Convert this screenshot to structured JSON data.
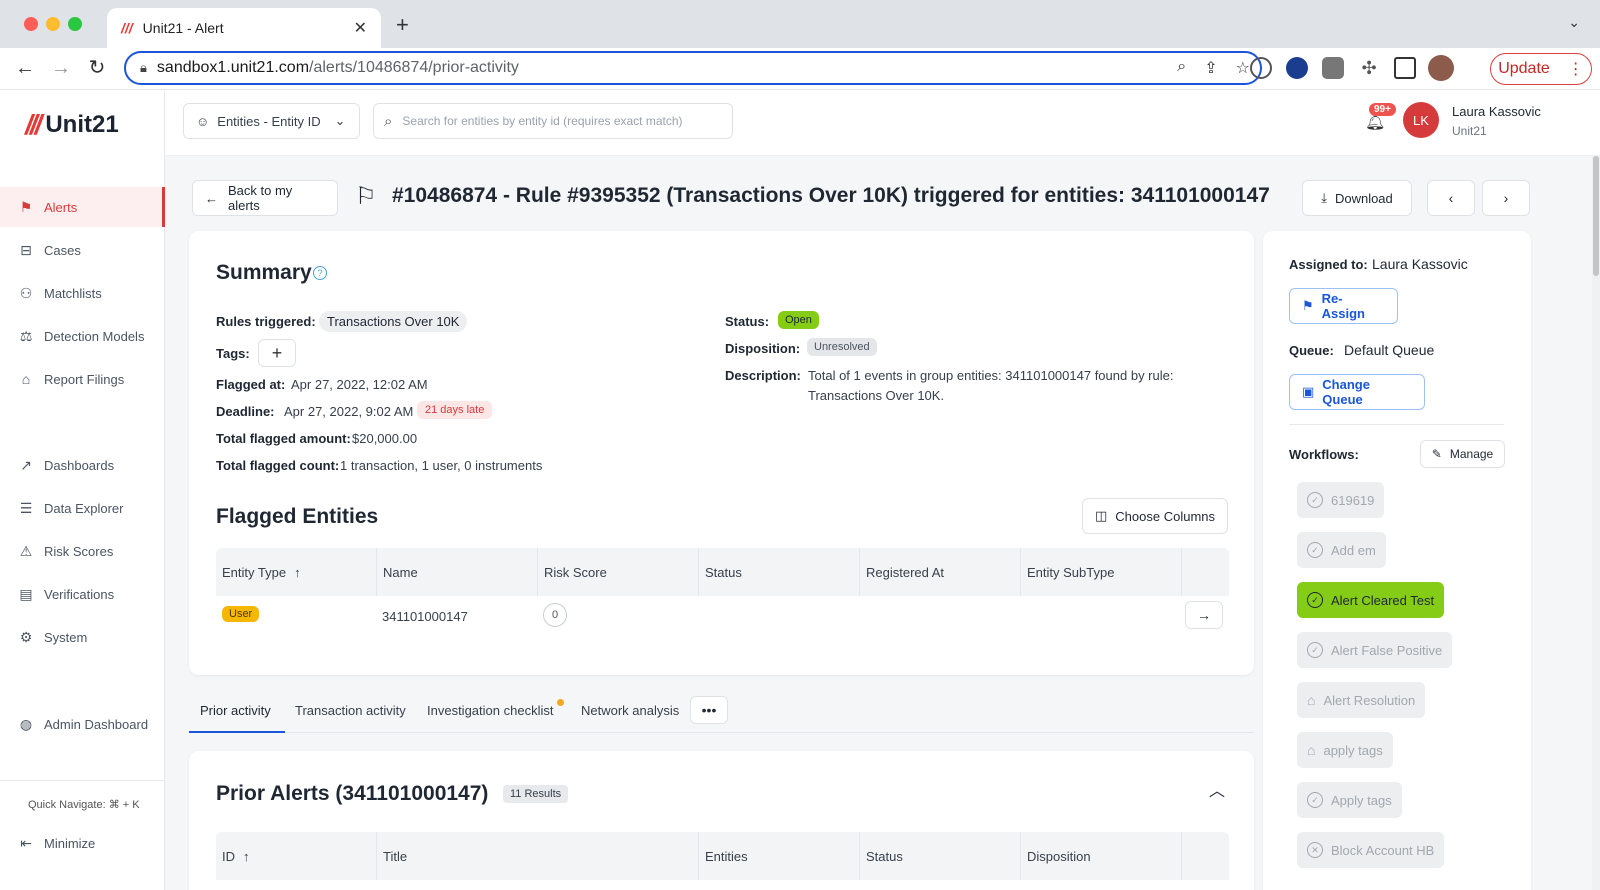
{
  "browser": {
    "tab_title": "Unit21 - Alert",
    "url_host": "sandbox1.unit21.com",
    "url_path": "/alerts/10486874/prior-activity",
    "update_label": "Update"
  },
  "app": {
    "logo_text": "Unit21",
    "sidebar": {
      "items": [
        {
          "label": "Alerts",
          "icon": "flag-icon"
        },
        {
          "label": "Cases",
          "icon": "briefcase-icon"
        },
        {
          "label": "Matchlists",
          "icon": "user-x-icon"
        },
        {
          "label": "Detection Models",
          "icon": "scale-icon"
        },
        {
          "label": "Report Filings",
          "icon": "bank-icon"
        },
        {
          "label": "Dashboards",
          "icon": "chart-line-icon"
        },
        {
          "label": "Data Explorer",
          "icon": "list-search-icon"
        },
        {
          "label": "Risk Scores",
          "icon": "warning-icon"
        },
        {
          "label": "Verifications",
          "icon": "id-card-icon"
        },
        {
          "label": "System",
          "icon": "gear-icon"
        },
        {
          "label": "Admin Dashboard",
          "icon": "globe-icon"
        }
      ],
      "quick_navigate": "Quick Navigate: ⌘ + K",
      "minimize": "Minimize"
    },
    "topbar": {
      "entity_select": "Entities - Entity ID",
      "search_placeholder": "Search for entities by entity id (requires exact match)",
      "notifications": "99+",
      "user_initials": "LK",
      "user_name": "Laura Kassovic",
      "user_org": "Unit21"
    }
  },
  "alert": {
    "back_label": "Back to my alerts",
    "title": "#10486874 - Rule #9395352 (Transactions Over 10K) triggered for entities: 341101000147",
    "download_label": "Download",
    "summary": {
      "heading": "Summary",
      "rules_triggered_label": "Rules triggered:",
      "rules_triggered_value": "Transactions Over 10K",
      "tags_label": "Tags:",
      "flagged_at_label": "Flagged at:",
      "flagged_at_value": "Apr 27, 2022, 12:02 AM",
      "deadline_label": "Deadline:",
      "deadline_value": "Apr 27, 2022, 9:02 AM",
      "deadline_badge": "21 days late",
      "total_amount_label": "Total flagged amount:",
      "total_amount_value": "$20,000.00",
      "total_count_label": "Total flagged count:",
      "total_count_value": "1 transaction, 1 user, 0 instruments",
      "status_label": "Status:",
      "status_value": "Open",
      "disposition_label": "Disposition:",
      "disposition_value": "Unresolved",
      "description_label": "Description:",
      "description_line1": "Total of 1 events in group entities: 341101000147 found by rule:",
      "description_line2": "Transactions Over 10K."
    },
    "flagged_entities": {
      "heading": "Flagged Entities",
      "choose_columns": "Choose Columns",
      "columns": [
        "Entity Type",
        "Name",
        "Risk Score",
        "Status",
        "Registered At",
        "Entity SubType"
      ],
      "rows": [
        {
          "entity_type": "User",
          "name": "341101000147",
          "risk_score": "0"
        }
      ]
    },
    "tabs": [
      "Prior activity",
      "Transaction activity",
      "Investigation checklist",
      "Network analysis"
    ],
    "prior_alerts": {
      "heading": "Prior Alerts (341101000147)",
      "results": "11 Results",
      "columns": [
        "ID",
        "Title",
        "Entities",
        "Status",
        "Disposition"
      ]
    }
  },
  "right_panel": {
    "assigned_label": "Assigned to:",
    "assigned_value": "Laura Kassovic",
    "reassign": "Re-Assign",
    "queue_label": "Queue:",
    "queue_value": "Default Queue",
    "change_queue": "Change Queue",
    "workflows_label": "Workflows:",
    "manage": "Manage",
    "workflows": [
      {
        "label": "619619",
        "active": false,
        "icon": "check-circle-icon"
      },
      {
        "label": "Add em",
        "active": false,
        "icon": "check-circle-icon"
      },
      {
        "label": "Alert Cleared Test",
        "active": true,
        "icon": "check-circle-icon"
      },
      {
        "label": "Alert False Positive",
        "active": false,
        "icon": "check-circle-icon"
      },
      {
        "label": "Alert Resolution",
        "active": false,
        "icon": "tag-icon"
      },
      {
        "label": "apply tags",
        "active": false,
        "icon": "tag-icon"
      },
      {
        "label": "Apply tags",
        "active": false,
        "icon": "check-circle-icon"
      },
      {
        "label": "Block Account HB",
        "active": false,
        "icon": "x-circle-icon"
      }
    ]
  },
  "colors": {
    "accent_red": "#d63b3b",
    "link_blue": "#1a56db",
    "open_green": "#84cc16",
    "user_badge": "#f5b700"
  }
}
